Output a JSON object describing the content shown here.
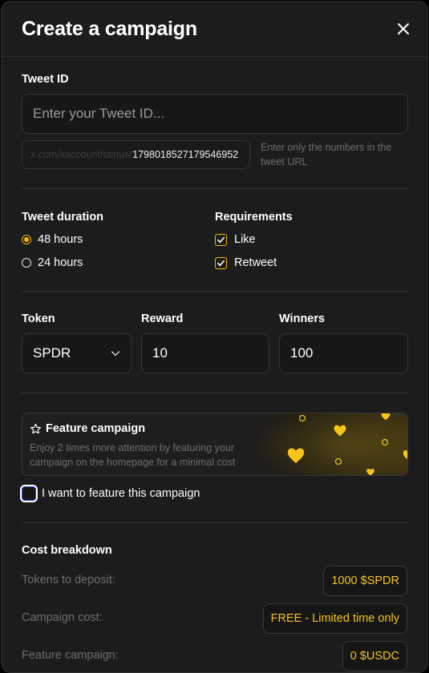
{
  "modal": {
    "title": "Create a campaign"
  },
  "tweet_id": {
    "label": "Tweet ID",
    "placeholder": "Enter your Tweet ID...",
    "value": "",
    "url_prefix": "x.com/xaccount/status/",
    "url_id": "1798018527179546952",
    "hint": "Enter only the numbers in the tweet URL"
  },
  "duration": {
    "label": "Tweet duration",
    "options": [
      {
        "label": "48 hours",
        "selected": true
      },
      {
        "label": "24 hours",
        "selected": false
      }
    ]
  },
  "requirements": {
    "label": "Requirements",
    "items": [
      {
        "label": "Like",
        "checked": true
      },
      {
        "label": "Retweet",
        "checked": true
      }
    ]
  },
  "token": {
    "label": "Token",
    "value": "SPDR"
  },
  "reward": {
    "label": "Reward",
    "value": "10"
  },
  "winners": {
    "label": "Winners",
    "value": "100"
  },
  "feature": {
    "title": "Feature campaign",
    "description": "Enjoy 2 times more attention by featuring your campaign on the homepage for a minimal cost",
    "checkbox_label": "I want to feature this campaign",
    "checked": false
  },
  "cost": {
    "title": "Cost breakdown",
    "rows": [
      {
        "label": "Tokens to deposit:",
        "value": "1000 $SPDR"
      },
      {
        "label": "Campaign cost:",
        "value": "FREE - Limited time only"
      },
      {
        "label": "Feature campaign:",
        "value": "0 $USDC"
      }
    ]
  },
  "colors": {
    "accent": "#f5b800",
    "background": "#1c1c1c",
    "muted": "#6e6e6e",
    "focus": "#2b4fd8"
  }
}
